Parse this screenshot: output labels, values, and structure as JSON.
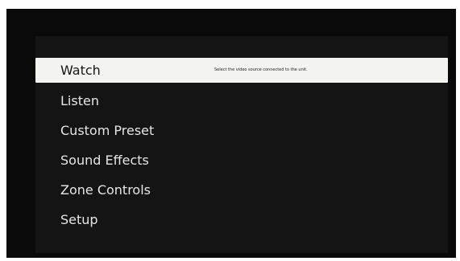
{
  "menu": {
    "items": [
      {
        "label": "Watch",
        "selected": true,
        "hint": "Select the video source connected to the unit."
      },
      {
        "label": "Listen",
        "selected": false
      },
      {
        "label": "Custom Preset",
        "selected": false
      },
      {
        "label": "Sound Effects",
        "selected": false
      },
      {
        "label": "Zone Controls",
        "selected": false
      },
      {
        "label": "Setup",
        "selected": false
      }
    ]
  },
  "colors": {
    "background": "#0a0a0a",
    "panel": "#141414",
    "highlight": "#f3f4f1",
    "text": "#e6e6e6"
  }
}
